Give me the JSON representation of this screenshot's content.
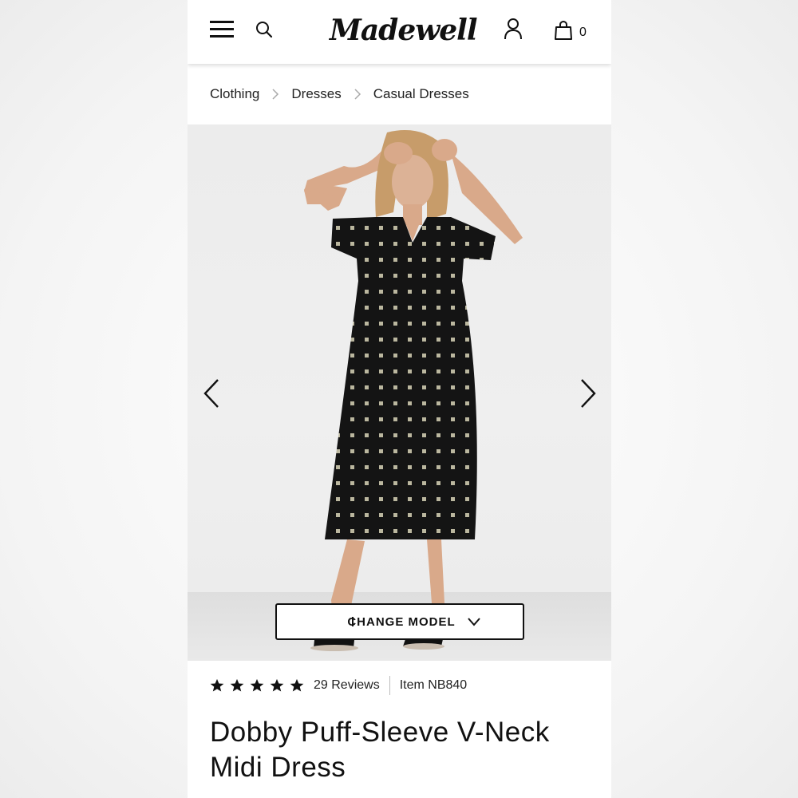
{
  "header": {
    "logo": "Madewell",
    "bag_count": "0"
  },
  "breadcrumb": {
    "items": [
      "Clothing",
      "Dresses",
      "Casual Dresses"
    ]
  },
  "gallery": {
    "change_model_label": "CHANGE MODEL"
  },
  "product": {
    "rating_stars": 5,
    "reviews": "29 Reviews",
    "item": "Item NB840",
    "title": "Dobby Puff-Sleeve V-Neck Midi Dress"
  },
  "colors": {
    "dress": "#141414",
    "dot": "#d8d4b8",
    "skin": "#d9a98a",
    "hair": "#c79c6a"
  }
}
